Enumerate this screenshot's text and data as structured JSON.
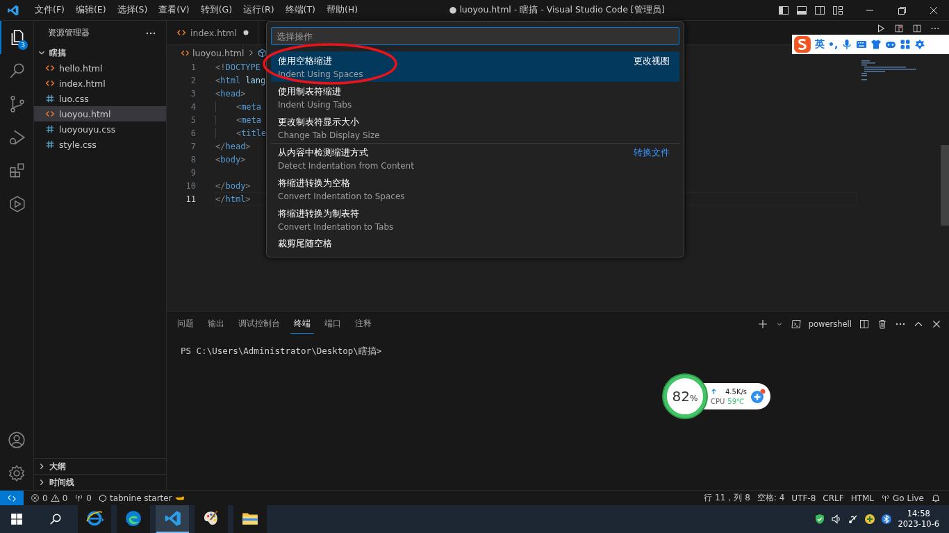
{
  "menu_bar": {
    "items": [
      "文件(F)",
      "编辑(E)",
      "选择(S)",
      "查看(V)",
      "转到(G)",
      "运行(R)",
      "终端(T)",
      "帮助(H)"
    ],
    "title": "● luoyou.html - 瞎搞 - Visual Studio Code [管理员]"
  },
  "activity_bar": {
    "items": [
      {
        "kind": "explorer",
        "selected": true,
        "badge": "3"
      },
      {
        "kind": "search",
        "selected": false
      },
      {
        "kind": "source-control",
        "selected": false
      },
      {
        "kind": "run-debug",
        "selected": false
      },
      {
        "kind": "extensions",
        "selected": false
      },
      {
        "kind": "hexagon",
        "selected": false
      }
    ]
  },
  "sidebar": {
    "title": "资源管理器",
    "folder": {
      "name": "瞎搞",
      "expanded": true,
      "children": [
        {
          "name": "hello.html",
          "kind": "html",
          "selected": false
        },
        {
          "name": "index.html",
          "kind": "html",
          "selected": false
        },
        {
          "name": "luo.css",
          "kind": "css",
          "selected": false
        },
        {
          "name": "luoyou.html",
          "kind": "html",
          "selected": true
        },
        {
          "name": "luoyouyu.css",
          "kind": "css",
          "selected": false
        },
        {
          "name": "style.css",
          "kind": "css",
          "selected": false
        }
      ]
    },
    "sections": [
      {
        "name": "大纲",
        "expanded": false
      },
      {
        "name": "时间线",
        "expanded": false
      }
    ]
  },
  "editor": {
    "tabs": [
      {
        "label": "index.html",
        "kind": "html",
        "modified": true
      }
    ],
    "breadcrumb": "luoyou.html",
    "lines": [
      {
        "number": "1",
        "text": "<!DOCTYPE",
        "current": false
      },
      {
        "number": "2",
        "text": "<html lang",
        "current": false
      },
      {
        "number": "3",
        "text": "<head>",
        "current": false
      },
      {
        "number": "4",
        "text": "    <meta",
        "current": false
      },
      {
        "number": "5",
        "text": "    <meta",
        "current": false
      },
      {
        "number": "6",
        "text": "    <title",
        "current": false
      },
      {
        "number": "7",
        "text": "</head>",
        "current": false
      },
      {
        "number": "8",
        "text": "<body>",
        "current": false
      },
      {
        "number": "9",
        "current": false
      },
      {
        "number": "10",
        "text": "</body>",
        "current": false
      },
      {
        "number": "11",
        "text": "</html>",
        "current": true
      }
    ]
  },
  "quick_pick": {
    "placeholder": "选择操作",
    "items": [
      {
        "label": "使用空格缩进",
        "detail": "Indent Using Spaces",
        "group": "更改视图",
        "selected": true
      },
      {
        "label": "使用制表符缩进",
        "detail": "Indent Using Tabs",
        "selected": false
      },
      {
        "label": "更改制表符显示大小",
        "detail": "Change Tab Display Size",
        "selected": false
      },
      {
        "label": "从内容中检测缩进方式",
        "detail": "Detect Indentation from Content",
        "group": "转换文件",
        "selected": false
      },
      {
        "label": "将缩进转换为空格",
        "detail": "Convert Indentation to Spaces",
        "selected": false
      },
      {
        "label": "将缩进转换为制表符",
        "detail": "Convert Indentation to Tabs",
        "selected": false
      },
      {
        "label": "裁剪尾随空格",
        "selected": false
      }
    ]
  },
  "ime_bar": {
    "mode": "英",
    "punctuation": "•,"
  },
  "panel": {
    "tabs": [
      {
        "label": "问题",
        "selected": false
      },
      {
        "label": "输出",
        "selected": false
      },
      {
        "label": "调试控制台",
        "selected": false
      },
      {
        "label": "终端",
        "selected": true
      },
      {
        "label": "端口",
        "selected": false
      },
      {
        "label": "注释",
        "selected": false
      }
    ],
    "terminal_profile": "powershell",
    "terminal_lines": [
      "PS C:\\Users\\Administrator\\Desktop\\瞎搞>"
    ]
  },
  "monitor_widget": {
    "percent": "82",
    "unit": "%",
    "speed": "4.5K/s",
    "cpu_label": "CPU",
    "temperature": "59℃"
  },
  "status_bar": {
    "errors": "0",
    "warnings": "0",
    "ports": "0",
    "extension": "tabnine starter",
    "right": [
      {
        "kind": "text",
        "label": "行 11，列 8"
      },
      {
        "kind": "text",
        "label": "空格: 4"
      },
      {
        "kind": "text",
        "label": "UTF-8"
      },
      {
        "kind": "text",
        "label": "CRLF"
      },
      {
        "kind": "text",
        "label": "HTML"
      },
      {
        "kind": "live",
        "label": "Go Live"
      }
    ]
  },
  "taskbar": {
    "apps": [
      {
        "kind": "ie",
        "active": false
      },
      {
        "kind": "edge",
        "active": false
      },
      {
        "kind": "vscode",
        "active": true
      },
      {
        "kind": "paint",
        "active": false
      },
      {
        "kind": "folder",
        "active": false
      }
    ],
    "time": "14:58",
    "date": "2023-10-6"
  }
}
